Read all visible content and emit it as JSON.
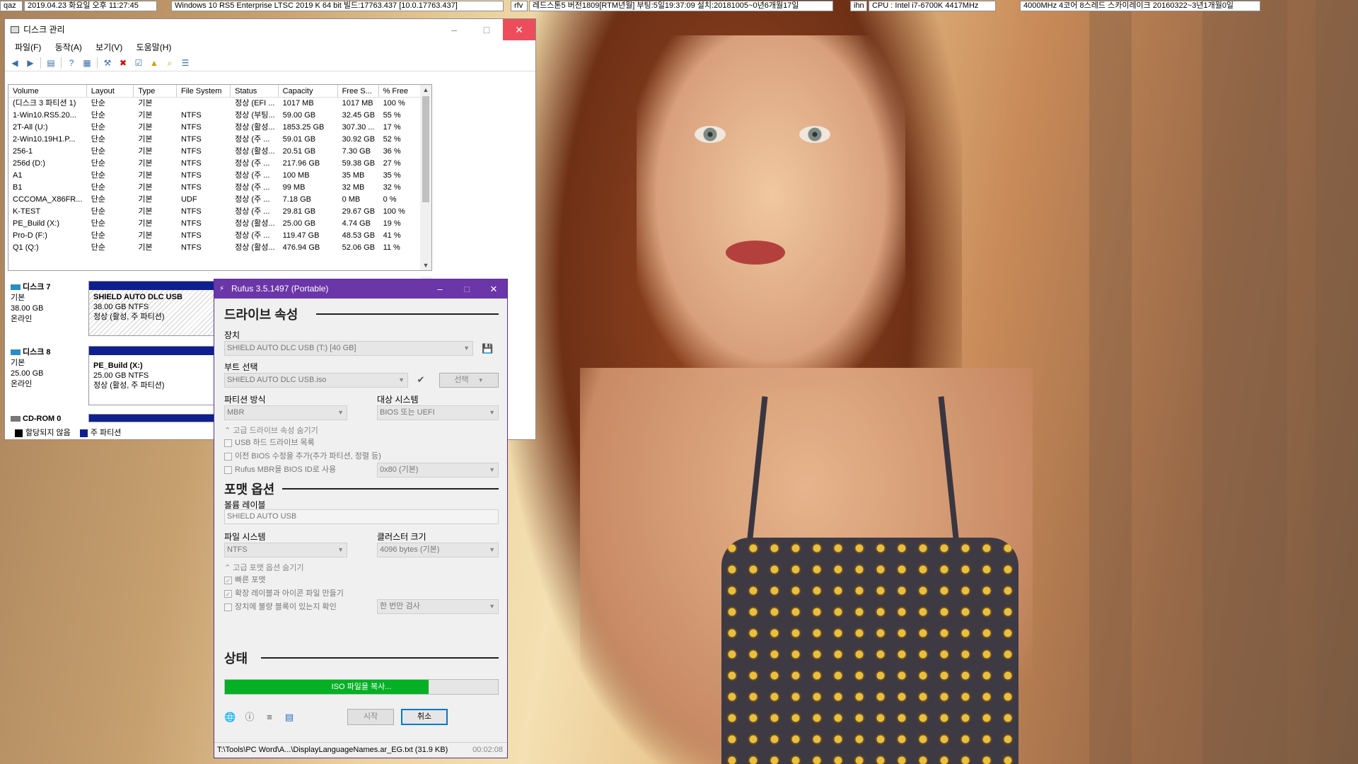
{
  "topbar": {
    "seg1": "qaz",
    "seg2": "2019.04.23 화요일 오후 11:27:45",
    "seg3": "Windows 10 RS5 Enterprise LTSC 2019 K 64 bit 빌드:17763.437 [10.0.17763.437]",
    "seg4": "rfv",
    "seg5": "레드스톤5 버전1809[RTM년월] 부팅:5일19:37:09 설치:20181005~0년6개월17일",
    "seg6": "ihn",
    "seg7": "CPU : Intel i7-6700K 4417MHz",
    "seg8": "4000MHz 4코어 8스레드 스카이레이크 20160322~3년1개월0일"
  },
  "disk_mgmt": {
    "title": "디스크 관리",
    "menu": [
      "파일(F)",
      "동작(A)",
      "보기(V)",
      "도움말(H)"
    ],
    "columns": [
      "Volume",
      "Layout",
      "Type",
      "File System",
      "Status",
      "Capacity",
      "Free S...",
      "% Free"
    ],
    "rows": [
      [
        "(디스크 3 파티션 1)",
        "단순",
        "기본",
        "",
        "정상 (EFI ...",
        "1017 MB",
        "1017 MB",
        "100 %"
      ],
      [
        "1-Win10.RS5.20...",
        "단순",
        "기본",
        "NTFS",
        "정상 (부팅...",
        "59.00 GB",
        "32.45 GB",
        "55 %"
      ],
      [
        "2T-All (U:)",
        "단순",
        "기본",
        "NTFS",
        "정상 (활성...",
        "1853.25 GB",
        "307.30 ...",
        "17 %"
      ],
      [
        "2-Win10.19H1.P...",
        "단순",
        "기본",
        "NTFS",
        "정상 (주 ...",
        "59.01 GB",
        "30.92 GB",
        "52 %"
      ],
      [
        "256-1",
        "단순",
        "기본",
        "NTFS",
        "정상 (활성...",
        "20.51 GB",
        "7.30 GB",
        "36 %"
      ],
      [
        "256d (D:)",
        "단순",
        "기본",
        "NTFS",
        "정상 (주 ...",
        "217.96 GB",
        "59.38 GB",
        "27 %"
      ],
      [
        "A1",
        "단순",
        "기본",
        "NTFS",
        "정상 (주 ...",
        "100 MB",
        "35 MB",
        "35 %"
      ],
      [
        "B1",
        "단순",
        "기본",
        "NTFS",
        "정상 (주 ...",
        "99 MB",
        "32 MB",
        "32 %"
      ],
      [
        "CCCOMA_X86FR...",
        "단순",
        "기본",
        "UDF",
        "정상 (주 ...",
        "7.18 GB",
        "0 MB",
        "0 %"
      ],
      [
        "K-TEST",
        "단순",
        "기본",
        "NTFS",
        "정상 (주 ...",
        "29.81 GB",
        "29.67 GB",
        "100 %"
      ],
      [
        "PE_Build (X:)",
        "단순",
        "기본",
        "NTFS",
        "정상 (활성...",
        "25.00 GB",
        "4.74 GB",
        "19 %"
      ],
      [
        "Pro-D (F:)",
        "단순",
        "기본",
        "NTFS",
        "정상 (주 ...",
        "119.47 GB",
        "48.53 GB",
        "41 %"
      ],
      [
        "Q1 (Q:)",
        "단순",
        "기본",
        "NTFS",
        "정상 (활성...",
        "476.94 GB",
        "52.06 GB",
        "11 %"
      ]
    ],
    "disks": [
      {
        "name": "디스크 7",
        "type": "기본",
        "size": "38.00 GB",
        "state": "온라인",
        "part_name": "SHIELD AUTO DLC USB",
        "part_size": "38.00 GB NTFS",
        "part_status": "정상 (활성, 주 파티션)"
      },
      {
        "name": "디스크 8",
        "type": "기본",
        "size": "25.00 GB",
        "state": "온라인",
        "part_name": "PE_Build  (X:)",
        "part_size": "25.00 GB NTFS",
        "part_status": "정상 (활성, 주 파티션)"
      },
      {
        "name": "CD-ROM 0"
      }
    ],
    "legend": {
      "unallocated": "할당되지 않음",
      "primary": "주 파티션"
    },
    "colors": {
      "primary": "#0f1f8f",
      "unallocated": "#000000"
    }
  },
  "rufus": {
    "title": "Rufus 3.5.1497 (Portable)",
    "drive_section": "드라이브 속성",
    "device_label": "장치",
    "device_value": "SHIELD AUTO DLC USB (T:) [40 GB]",
    "boot_label": "부트 선택",
    "boot_value": "SHIELD AUTO DLC USB.iso",
    "select_button": "선택",
    "partition_label": "파티션 방식",
    "partition_value": "MBR",
    "target_label": "대상 시스템",
    "target_value": "BIOS 또는 UEFI",
    "adv_drive_toggle": "고급 드라이브 속성 숨기기",
    "chk_usb_hdd": "USB 하드 드라이브 목록",
    "chk_old_bios": "이전 BIOS 수정을 추가(추가 파티션, 정렬 등)",
    "chk_rufus_mbr": "Rufus MBR을 BIOS ID로 사용",
    "bios_id_value": "0x80 (기본)",
    "format_section": "포맷 옵션",
    "volume_label": "볼륨 레이블",
    "volume_value": "SHIELD AUTO USB",
    "fs_label": "파일 시스템",
    "fs_value": "NTFS",
    "cluster_label": "클러스터 크기",
    "cluster_value": "4096 bytes (기본)",
    "adv_format_toggle": "고급 포맷 옵션 숨기기",
    "chk_quick": "빠른 포맷",
    "chk_extended": "확장 레이블과 아이콘 파일 만들기",
    "chk_badblocks": "장치에 불량 블록이 있는지 확인",
    "badblock_value": "한 번만 검사",
    "status_section": "상태",
    "progress_text": "ISO 파일을 복사...",
    "progress_fraction": 0.745,
    "start_button": "시작",
    "cancel_button": "취소",
    "statusbar_text": "T:\\Tools\\PC Word\\A...\\DisplayLanguageNames.ar_EG.txt (31.9 KB)",
    "statusbar_time": "00:02:08",
    "colors": {
      "titlebar": "#6b36a8",
      "progress": "#06b025",
      "focus": "#0078d7"
    }
  }
}
